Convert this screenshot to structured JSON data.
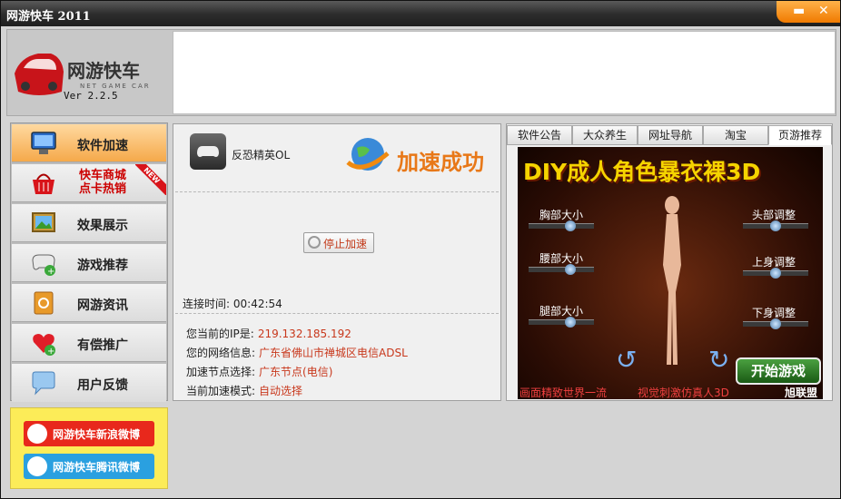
{
  "window": {
    "title": "网游快车 2011",
    "minimize_glyph": "▬",
    "close_glyph": "✕"
  },
  "header": {
    "version": "Ver 2.2.5",
    "logo_text": "网游快车"
  },
  "sidebar": {
    "items": [
      {
        "label": "软件加速",
        "icon": "monitor-icon",
        "active": true
      },
      {
        "label": "快车商城\n点卡热销",
        "icon": "shopping-basket-icon",
        "badge": "NEW"
      },
      {
        "label": "效果展示",
        "icon": "picture-icon"
      },
      {
        "label": "游戏推荐",
        "icon": "gamepad-icon"
      },
      {
        "label": "网游资讯",
        "icon": "address-book-icon"
      },
      {
        "label": "有偿推广",
        "icon": "heart-icon"
      },
      {
        "label": "用户反馈",
        "icon": "speech-bubble-icon"
      }
    ],
    "weibo": [
      {
        "label": "网游快车新浪微博",
        "color": "#e8281c"
      },
      {
        "label": "网游快车腾讯微博",
        "color": "#2aa0e0"
      }
    ]
  },
  "center": {
    "game_name": "反恐精英OL",
    "status": "加速成功",
    "stop_button": "停止加速",
    "connect_time_label": "连接时间:",
    "connect_time": "00:42:54",
    "info": [
      {
        "label": "您当前的IP是:",
        "value": "219.132.185.192"
      },
      {
        "label": "您的网络信息:",
        "value": "广东省佛山市禅城区电信ADSL"
      },
      {
        "label": "加速节点选择:",
        "value": "广东节点(电信)"
      },
      {
        "label": "当前加速模式:",
        "value": "自动选择"
      }
    ]
  },
  "right": {
    "tabs": [
      "软件公告",
      "大众养生",
      "网址导航",
      "淘宝",
      "页游推荐"
    ],
    "active_tab": 4,
    "ad": {
      "title": "DIY成人角色暴衣裸3D",
      "left_sliders": [
        "胸部大小",
        "腰部大小",
        "腿部大小"
      ],
      "right_sliders": [
        "头部调整",
        "上身调整",
        "下身调整"
      ],
      "start_button": "开始游戏",
      "footer_left": "画面精致世界一流",
      "footer_mid": "视觉刺激仿真人3D",
      "footer_brand": "旭联盟"
    }
  },
  "colors": {
    "accent": "#f08a10",
    "value_red": "#c8381c",
    "status_orange": "#e87818"
  }
}
